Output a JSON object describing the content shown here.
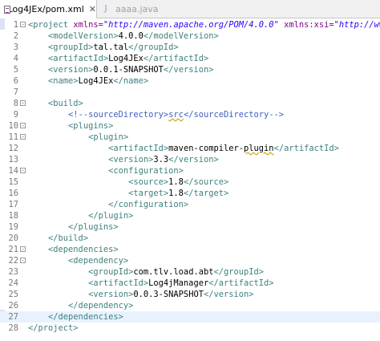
{
  "tabs": [
    {
      "label": "Log4JEx/pom.xml",
      "close": "✕",
      "active": true,
      "icon": "xml-file-icon"
    },
    {
      "label": "aaaa.java",
      "active": false,
      "icon": "java-file-icon"
    }
  ],
  "editor": {
    "lines": [
      {
        "n": "1",
        "parts": [
          [
            "tag",
            "<project "
          ],
          [
            "attr",
            "xmlns="
          ],
          [
            "str",
            "\"http://maven.apache.org/POM/4.0.0\""
          ],
          [
            "txt",
            " "
          ],
          [
            "attr",
            "xmlns:xsi="
          ],
          [
            "str",
            "\"http://ww"
          ]
        ]
      },
      {
        "n": "2",
        "parts": [
          [
            "tag",
            "    <modelVersion>"
          ],
          [
            "txt",
            "4.0.0"
          ],
          [
            "tag",
            "</modelVersion>"
          ]
        ]
      },
      {
        "n": "3",
        "parts": [
          [
            "tag",
            "    <groupId>"
          ],
          [
            "txt",
            "tal.tal"
          ],
          [
            "tag",
            "</groupId>"
          ]
        ]
      },
      {
        "n": "4",
        "parts": [
          [
            "tag",
            "    <artifactId>"
          ],
          [
            "txt",
            "Log4JEx"
          ],
          [
            "tag",
            "</artifactId>"
          ]
        ]
      },
      {
        "n": "5",
        "parts": [
          [
            "tag",
            "    <version>"
          ],
          [
            "txt",
            "0.0.1-SNAPSHOT"
          ],
          [
            "tag",
            "</version>"
          ]
        ]
      },
      {
        "n": "6",
        "parts": [
          [
            "tag",
            "    <name>"
          ],
          [
            "txt",
            "Log4JEx"
          ],
          [
            "tag",
            "</name>"
          ]
        ]
      },
      {
        "n": "7",
        "parts": []
      },
      {
        "n": "8",
        "parts": [
          [
            "tag",
            "    <build>"
          ]
        ]
      },
      {
        "n": "9",
        "parts": [
          [
            "cmt",
            "        <!--sourceDirectory>"
          ],
          [
            "cmt_u",
            "src"
          ],
          [
            "cmt",
            "</sourceDirectory-->"
          ]
        ]
      },
      {
        "n": "10",
        "parts": [
          [
            "tag",
            "        <plugins>"
          ]
        ]
      },
      {
        "n": "11",
        "parts": [
          [
            "tag",
            "            <plugin>"
          ]
        ]
      },
      {
        "n": "12",
        "parts": [
          [
            "tag",
            "                <artifactId>"
          ],
          [
            "txt",
            "maven-compiler-"
          ],
          [
            "txt_u",
            "plugin"
          ],
          [
            "tag",
            "</artifactId>"
          ]
        ]
      },
      {
        "n": "13",
        "parts": [
          [
            "tag",
            "                <version>"
          ],
          [
            "txt",
            "3.3"
          ],
          [
            "tag",
            "</version>"
          ]
        ]
      },
      {
        "n": "14",
        "parts": [
          [
            "tag",
            "                <configuration>"
          ]
        ]
      },
      {
        "n": "15",
        "parts": [
          [
            "tag",
            "                    <source>"
          ],
          [
            "txt",
            "1.8"
          ],
          [
            "tag",
            "</source>"
          ]
        ]
      },
      {
        "n": "16",
        "parts": [
          [
            "tag",
            "                    <target>"
          ],
          [
            "txt",
            "1.8"
          ],
          [
            "tag",
            "</target>"
          ]
        ]
      },
      {
        "n": "17",
        "parts": [
          [
            "tag",
            "                </configuration>"
          ]
        ]
      },
      {
        "n": "18",
        "parts": [
          [
            "tag",
            "            </plugin>"
          ]
        ]
      },
      {
        "n": "19",
        "parts": [
          [
            "tag",
            "        </plugins>"
          ]
        ]
      },
      {
        "n": "20",
        "parts": [
          [
            "tag",
            "    </build>"
          ]
        ]
      },
      {
        "n": "21",
        "parts": [
          [
            "tag",
            "    <dependencies>"
          ]
        ]
      },
      {
        "n": "22",
        "parts": [
          [
            "tag",
            "        <dependency>"
          ]
        ]
      },
      {
        "n": "23",
        "parts": [
          [
            "tag",
            "            <groupId>"
          ],
          [
            "txt",
            "com.tlv.load.abt"
          ],
          [
            "tag",
            "</groupId>"
          ]
        ]
      },
      {
        "n": "24",
        "parts": [
          [
            "tag",
            "            <artifactId>"
          ],
          [
            "txt",
            "Log4jManager"
          ],
          [
            "tag",
            "</artifactId>"
          ]
        ]
      },
      {
        "n": "25",
        "parts": [
          [
            "tag",
            "            <version>"
          ],
          [
            "txt",
            "0.0.3-SNAPSHOT"
          ],
          [
            "tag",
            "</version>"
          ]
        ]
      },
      {
        "n": "26",
        "parts": [
          [
            "tag",
            "        </dependency>"
          ]
        ]
      },
      {
        "n": "27",
        "parts": [
          [
            "tag",
            "    </dependencies>"
          ]
        ]
      },
      {
        "n": "28",
        "parts": [
          [
            "tag",
            "</project>"
          ]
        ]
      }
    ]
  },
  "colors": {
    "tag": "#3f7f7f",
    "attribute": "#7f007f",
    "string": "#2a00ff",
    "comment": "#3f5fbf",
    "current_line": "#e8f2fe"
  }
}
